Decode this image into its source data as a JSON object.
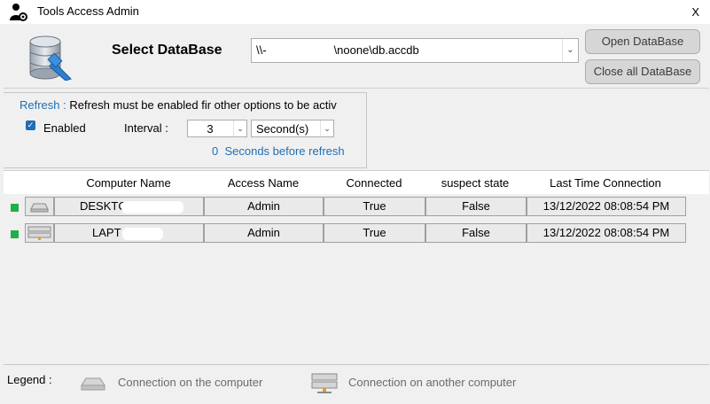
{
  "window": {
    "title": "Tools Access Admin",
    "close_label": "X"
  },
  "database": {
    "label": "Select DataBase",
    "path_prefix": "\\\\-",
    "path_suffix": "\\noone\\db.accdb",
    "open_button": "Open DataBase",
    "close_all_button": "Close all DataBase"
  },
  "refresh": {
    "link_label": "Refresh :",
    "message": "Refresh must be enabled fir other options to be activ",
    "enabled_label": "Enabled",
    "enabled_checked": true,
    "interval_label": "Interval :",
    "interval_value": "3",
    "unit_value": "Second(s)",
    "countdown_value": "0",
    "countdown_text": "Seconds before refresh"
  },
  "grid": {
    "columns": [
      "Computer Name",
      "Access Name",
      "Connected",
      "suspect state",
      "Last Time Connection"
    ],
    "rows": [
      {
        "computer": "DESKTC",
        "access": "Admin",
        "connected": "True",
        "suspect": "False",
        "last": "13/12/2022 08:08:54 PM",
        "status_color": "#20b04a",
        "icon": "local-computer-icon"
      },
      {
        "computer": "LAPT",
        "access": "Admin",
        "connected": "True",
        "suspect": "False",
        "last": "13/12/2022 08:08:54 PM",
        "status_color": "#20b04a",
        "icon": "network-computer-icon"
      }
    ]
  },
  "legend": {
    "label": "Legend :",
    "local": "Connection on the computer",
    "remote": "Connection on another computer"
  },
  "colors": {
    "accent": "#1f6fb5",
    "status_ok": "#20b04a"
  }
}
